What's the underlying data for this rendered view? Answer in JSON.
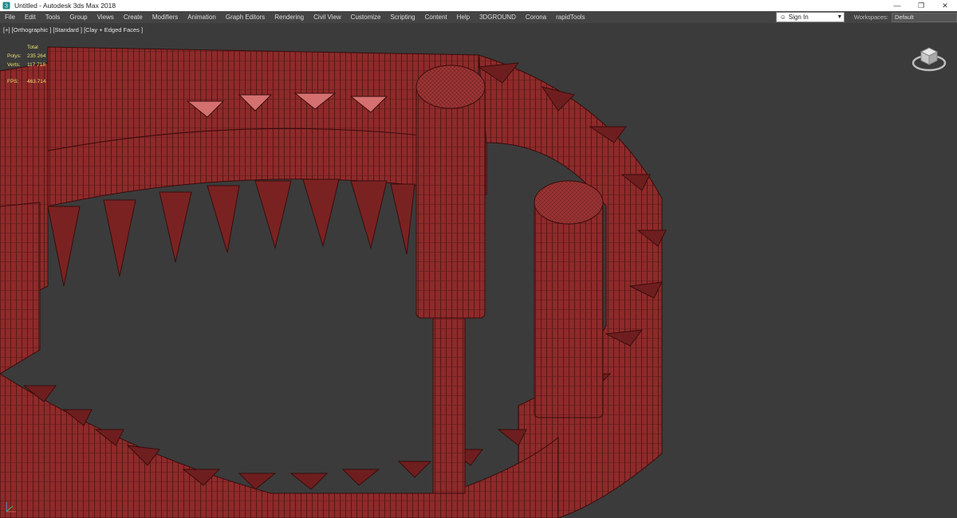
{
  "window": {
    "title": "Untitled - Autodesk 3ds Max 2018",
    "app_icon": "3ds-max-icon",
    "controls": [
      "minimize-icon",
      "restore-icon",
      "close-icon"
    ]
  },
  "menubar": {
    "items": [
      "File",
      "Edit",
      "Tools",
      "Group",
      "Views",
      "Create",
      "Modifiers",
      "Animation",
      "Graph Editors",
      "Rendering",
      "Civil View",
      "Customize",
      "Scripting",
      "Content",
      "Help",
      "3DGROUND",
      "Corona",
      "rapidTools"
    ],
    "sign_in": "Sign In",
    "workspaces_label": "Workspaces:",
    "workspace_value": "Default"
  },
  "viewport": {
    "label": "[+] [Orthographic ] [Standard ] [Clay + Edged Faces ]",
    "stats": {
      "total_label": "Total",
      "polys_label": "Polys:",
      "polys_value": "235 264",
      "verts_label": "Verts:",
      "verts_value": "117 718",
      "fps_label": "FPS:",
      "fps_value": "463.714"
    },
    "viewcube": "viewcube-icon",
    "colors": {
      "background": "#3b3b3b",
      "clay": "#8e2a2a",
      "edge": "#3a0c0c",
      "stats_text": "#e8e070"
    }
  }
}
